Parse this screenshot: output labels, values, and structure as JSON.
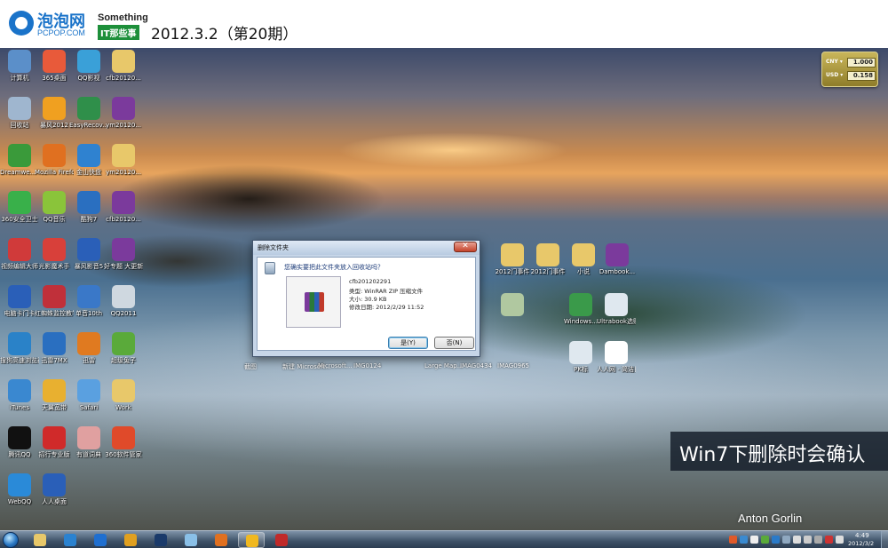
{
  "banner": {
    "logo_main": "泡泡网",
    "logo_sub": "PCPOP.COM",
    "brand_top": "Something",
    "brand_bottom": "IT那些事",
    "issue_date": "2012.3.2（第20期）"
  },
  "desktop": {
    "icons": [
      {
        "label": "计算机",
        "color": "#5b8fc9"
      },
      {
        "label": "365桌面",
        "color": "#e85a3a"
      },
      {
        "label": "QQ影视",
        "color": "#3aa0d8"
      },
      {
        "label": "cfb20120...",
        "color": "#e8c86a"
      },
      {
        "label": "回收站",
        "color": "#9fb6cf"
      },
      {
        "label": "暴风2012",
        "color": "#f0a020"
      },
      {
        "label": "EasyRecov... Professiona...",
        "color": "#2f8f4a"
      },
      {
        "label": "ym20120...",
        "color": "#7b3a9c"
      },
      {
        "label": "Dreamwe... CS3",
        "color": "#3a9a3a"
      },
      {
        "label": "Mozilla Firefox",
        "color": "#e07020"
      },
      {
        "label": "金山快盘",
        "color": "#2f82d0"
      },
      {
        "label": "ym20120...",
        "color": "#e8c86a"
      },
      {
        "label": "360安全卫士",
        "color": "#39b04a"
      },
      {
        "label": "QQ音乐",
        "color": "#8ac43a"
      },
      {
        "label": "酷狗7",
        "color": "#2a6fc0"
      },
      {
        "label": "cfb20120...",
        "color": "#7b3a9c"
      },
      {
        "label": "视频编辑大师",
        "color": "#d03a3a"
      },
      {
        "label": "光影魔术手",
        "color": "#d8403a"
      },
      {
        "label": "暴风影音5",
        "color": "#2a5fb8"
      },
      {
        "label": "好专题 大更新...",
        "color": "#7b3a9c"
      },
      {
        "label": "电脑卡门卡",
        "color": "#2a5fb8"
      },
      {
        "label": "红蜘蛛监控教学",
        "color": "#c0303a"
      },
      {
        "label": "单音10th",
        "color": "#3a78c8"
      },
      {
        "label": "QQ2011",
        "color": "#cfd8e0"
      },
      {
        "label": "搜狗高速浏览器",
        "color": "#2a82c8"
      },
      {
        "label": "迅雷7MX",
        "color": "#2a6fc0"
      },
      {
        "label": "迅雷",
        "color": "#e07a20"
      },
      {
        "label": "超级兔子",
        "color": "#5aaa3a"
      },
      {
        "label": "iTunes",
        "color": "#3a88d0"
      },
      {
        "label": "天翼宽带",
        "color": "#e8b030"
      },
      {
        "label": "Safari",
        "color": "#5aa0e0"
      },
      {
        "label": "Work",
        "color": "#e8c86a"
      },
      {
        "label": "腾讯QQ",
        "color": "#111111"
      },
      {
        "label": "招行专业版",
        "color": "#d02a2a"
      },
      {
        "label": "有道词典",
        "color": "#e0a0a0"
      },
      {
        "label": "360软件管家",
        "color": "#e04a2a"
      },
      {
        "label": "WebQQ",
        "color": "#2a8ad8"
      },
      {
        "label": "人人桌面",
        "color": "#2a5fb8"
      }
    ],
    "right_icons": [
      {
        "label": "2012门事件",
        "color": "#e8c86a"
      },
      {
        "label": "2012门事件",
        "color": "#e8c86a"
      },
      {
        "label": "小说",
        "color": "#e8c86a"
      },
      {
        "label": "Dambook...",
        "color": "#7b3a9c"
      },
      {
        "label": "",
        "color": "#b0c8a0"
      },
      {
        "label": "Windows...",
        "color": "#3a9a4a"
      },
      {
        "label": "Ultrabook选购指南...",
        "color": "#dfe8ef"
      },
      {
        "label": "PK标",
        "color": "#dfe8ef"
      },
      {
        "label": "人人网 - 简洁日本...",
        "color": "#ffffff"
      }
    ],
    "row_labels": [
      "截图",
      "新建 Microsoft...",
      "Microsoft...",
      "IMG0124",
      "Large Map...",
      "IMAG0434",
      "IMAG0965"
    ],
    "gadget": {
      "row1_label": "CNY ▾",
      "row1_value": "1.000",
      "row2_label": "USD ▾",
      "row2_value": "0.158"
    }
  },
  "dialog": {
    "title": "删除文件夹",
    "close_label": "✕",
    "question": "您确实要把此文件夹放入回收站吗？",
    "file_name": "cfb201202291",
    "file_type": "类型: WinRAR ZIP 压缩文件",
    "file_size": "大小: 30.9 KB",
    "file_modified": "修改日期: 2012/2/29 11:52",
    "yes_label": "是(Y)",
    "no_label": "否(N)"
  },
  "caption": {
    "text": "Win7下删除时会确认"
  },
  "credit": "Anton Gorlin",
  "taskbar": {
    "apps": [
      {
        "name": "explorer",
        "color": "#e8c86a"
      },
      {
        "name": "ie",
        "color": "#2a82d0"
      },
      {
        "name": "sogou",
        "color": "#1f6fd0"
      },
      {
        "name": "chrome",
        "color": "#e0a020"
      },
      {
        "name": "photoshop",
        "color": "#1a3a6a"
      },
      {
        "name": "window",
        "color": "#8ac0e8"
      },
      {
        "name": "firefox",
        "color": "#e07020"
      },
      {
        "name": "qq",
        "color": "#f0b820"
      },
      {
        "name": "remote",
        "color": "#c02a2a"
      }
    ],
    "time": "4:49",
    "date": "2012/3/2"
  }
}
